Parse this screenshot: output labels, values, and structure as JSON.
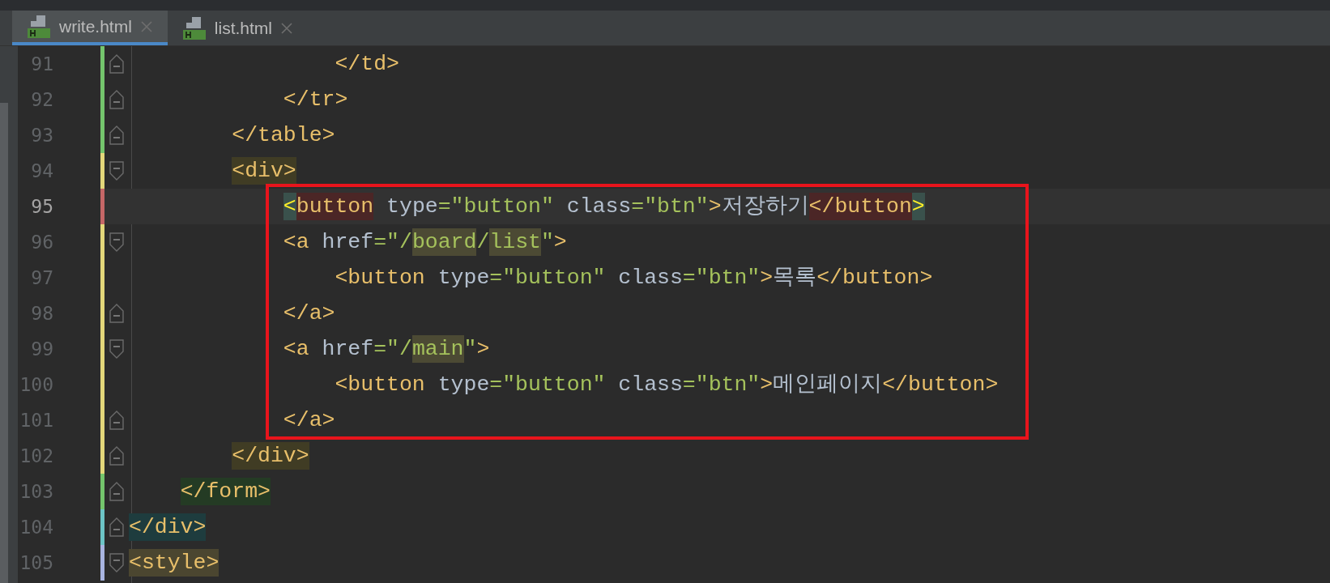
{
  "tabs": [
    {
      "label": "write.html",
      "selected": true
    },
    {
      "label": "list.html",
      "selected": false
    }
  ],
  "lines": [
    {
      "number": "91",
      "fold_open": false,
      "color": "#74c56c",
      "current": false,
      "boxed": false,
      "tokens": [
        {
          "kind": "tag",
          "text": "                </td>"
        }
      ]
    },
    {
      "number": "92",
      "fold_open": false,
      "color": "#74c56c",
      "current": false,
      "boxed": false,
      "tokens": [
        {
          "kind": "tag",
          "text": "            </tr>"
        }
      ]
    },
    {
      "number": "93",
      "fold_open": false,
      "color": "#74c56c",
      "current": false,
      "boxed": false,
      "tokens": [
        {
          "kind": "tag",
          "text": "        </table>"
        }
      ]
    },
    {
      "number": "94",
      "fold_open": true,
      "color": "#e3d77a",
      "current": false,
      "boxed": false,
      "tokens": [
        {
          "kind": "tag",
          "text": "        <div>",
          "color": "#403c24"
        }
      ]
    },
    {
      "number": "95",
      "color": "#c56767",
      "current": true,
      "boxed": true,
      "tokens": [
        {
          "kind": "brace",
          "text": "            <",
          "color": "#3a514c"
        },
        {
          "kind": "tag",
          "text": "button",
          "color": "#4b2626"
        },
        {
          "kind": "attr",
          "text": " type"
        },
        {
          "kind": "value",
          "text": "=\"button\""
        },
        {
          "kind": "attr",
          "text": " class"
        },
        {
          "kind": "value",
          "text": "=\"btn\""
        },
        {
          "kind": "tag",
          "text": ">"
        },
        {
          "kind": "text",
          "text": "저장하기"
        },
        {
          "kind": "tag",
          "text": "</button",
          "color": "#4b2626"
        },
        {
          "kind": "brace",
          "text": ">",
          "color": "#3a514c"
        }
      ]
    },
    {
      "number": "96",
      "fold_open": true,
      "color": "#e3d77a",
      "current": false,
      "boxed": true,
      "tokens": [
        {
          "kind": "tag",
          "text": "            <a"
        },
        {
          "kind": "attr",
          "text": " href"
        },
        {
          "kind": "value",
          "text": "=\"/"
        },
        {
          "kind": "value",
          "text": "board",
          "color": "#4c4a34"
        },
        {
          "kind": "value",
          "text": "/"
        },
        {
          "kind": "value",
          "text": "list",
          "color": "#4c4a34"
        },
        {
          "kind": "value",
          "text": "\""
        },
        {
          "kind": "tag",
          "text": ">"
        }
      ]
    },
    {
      "number": "97",
      "color": "#e3d77a",
      "current": false,
      "boxed": true,
      "tokens": [
        {
          "kind": "tag",
          "text": "                <button"
        },
        {
          "kind": "attr",
          "text": " type"
        },
        {
          "kind": "value",
          "text": "=\"button\""
        },
        {
          "kind": "attr",
          "text": " class"
        },
        {
          "kind": "value",
          "text": "=\"btn\""
        },
        {
          "kind": "tag",
          "text": ">"
        },
        {
          "kind": "text",
          "text": "목록"
        },
        {
          "kind": "tag",
          "text": "</button>"
        }
      ]
    },
    {
      "number": "98",
      "fold_open": false,
      "color": "#e3d77a",
      "current": false,
      "boxed": true,
      "tokens": [
        {
          "kind": "tag",
          "text": "            </a>"
        }
      ]
    },
    {
      "number": "99",
      "fold_open": true,
      "color": "#e3d77a",
      "current": false,
      "boxed": true,
      "tokens": [
        {
          "kind": "tag",
          "text": "            <a"
        },
        {
          "kind": "attr",
          "text": " href"
        },
        {
          "kind": "value",
          "text": "=\"/"
        },
        {
          "kind": "value",
          "text": "main",
          "color": "#4c4a34"
        },
        {
          "kind": "value",
          "text": "\""
        },
        {
          "kind": "tag",
          "text": ">"
        }
      ]
    },
    {
      "number": "100",
      "color": "#e3d77a",
      "current": false,
      "boxed": true,
      "tokens": [
        {
          "kind": "tag",
          "text": "                <button"
        },
        {
          "kind": "attr",
          "text": " type"
        },
        {
          "kind": "value",
          "text": "=\"button\""
        },
        {
          "kind": "attr",
          "text": " class"
        },
        {
          "kind": "value",
          "text": "=\"btn\""
        },
        {
          "kind": "tag",
          "text": ">"
        },
        {
          "kind": "text",
          "text": "메인페이지"
        },
        {
          "kind": "tag",
          "text": "</button>"
        }
      ]
    },
    {
      "number": "101",
      "fold_open": false,
      "color": "#e3d77a",
      "current": false,
      "boxed": true,
      "tokens": [
        {
          "kind": "tag",
          "text": "            </a>"
        }
      ]
    },
    {
      "number": "102",
      "fold_open": false,
      "color": "#e3d77a",
      "current": false,
      "boxed": false,
      "tokens": [
        {
          "kind": "tag",
          "text": "        </div>",
          "color": "#403c24"
        }
      ]
    },
    {
      "number": "103",
      "fold_open": false,
      "color": "#74c56c",
      "current": false,
      "boxed": false,
      "tokens": [
        {
          "kind": "tag",
          "text": "    </form>",
          "color": "#243b24"
        }
      ]
    },
    {
      "number": "104",
      "fold_open": false,
      "color": "#6cc4c6",
      "current": false,
      "boxed": false,
      "tokens": [
        {
          "kind": "tag",
          "text": "</div>",
          "color": "#1e3c3e"
        }
      ]
    },
    {
      "number": "105",
      "fold_open": true,
      "color": "#a8b4e0",
      "current": false,
      "boxed": false,
      "tokens": [
        {
          "kind": "tag",
          "text": "<style>",
          "color": "#4b4630"
        }
      ]
    }
  ]
}
